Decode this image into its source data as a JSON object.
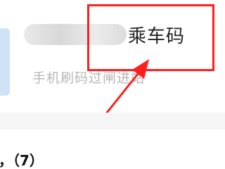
{
  "card": {
    "title_suffix": "乘车码",
    "subtitle": "手机刷码过闸进站"
  },
  "section": {
    "label": "，（7）"
  },
  "colors": {
    "highlight_red": "#ff1f1f",
    "text_dark": "#222222",
    "text_gray": "#b8b8b8",
    "thumb_blue": "#cfe3f7"
  }
}
